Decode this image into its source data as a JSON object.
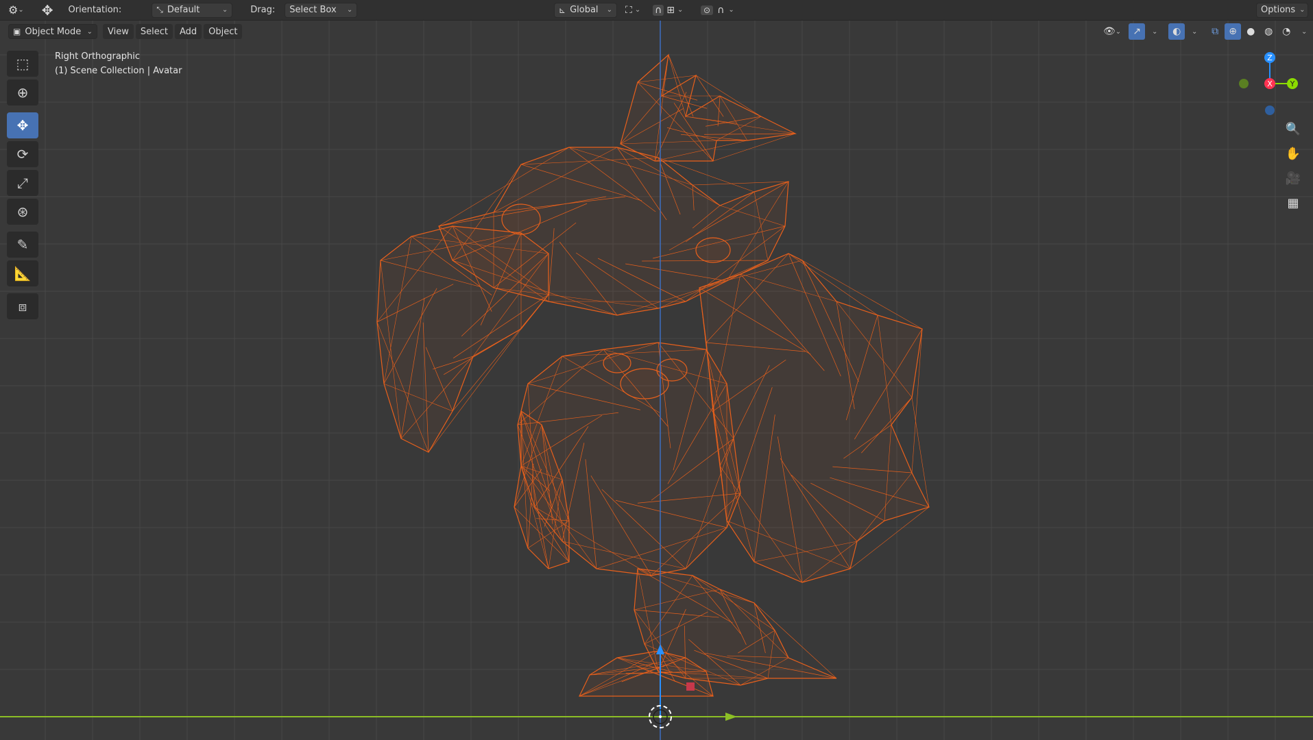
{
  "topbar": {
    "orientation_label": "Orientation:",
    "orientation_value": "Default",
    "drag_label": "Drag:",
    "drag_value": "Select Box",
    "transform_space": "Global",
    "options_label": "Options"
  },
  "viewport_header": {
    "mode": "Object Mode",
    "menus": [
      "View",
      "Select",
      "Add",
      "Object"
    ]
  },
  "view_info": {
    "line1": "Right Orthographic",
    "line2": "(1) Scene Collection | Avatar"
  },
  "gizmo": {
    "z": "Z",
    "y": "Y",
    "x": "X",
    "colors": {
      "x": "#ff3352",
      "y": "#8bdc00",
      "z": "#2890ff"
    }
  },
  "colors": {
    "wireframe": "#e8601c",
    "grid": "#4a4a4a",
    "background": "#393939",
    "floor_line": "#8cbf26",
    "z_axis_line": "#3d6fc2",
    "accent": "#4772b3"
  },
  "tools": [
    "select-box-icon",
    "cursor-icon",
    "move-icon",
    "rotate-icon",
    "scale-icon",
    "transform-icon",
    "annotate-icon",
    "measure-icon",
    "add-cube-icon"
  ],
  "nav_buttons": [
    "zoom-icon",
    "pan-hand-icon",
    "camera-icon",
    "grid-icon"
  ]
}
